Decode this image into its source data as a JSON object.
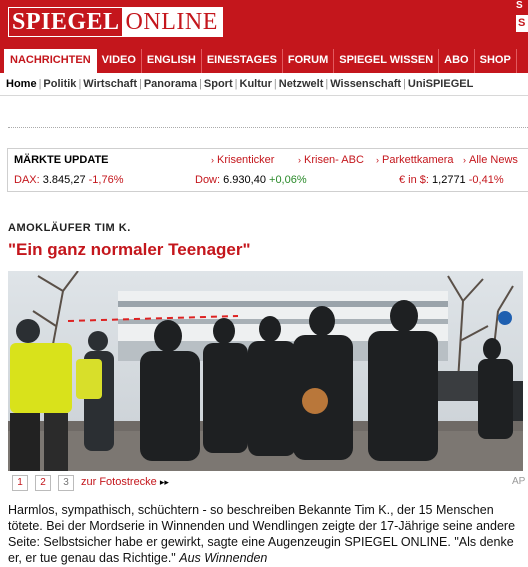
{
  "header": {
    "logo_left": "SPIEGEL",
    "logo_right": "ONLINE",
    "side_top": "S",
    "side_box": "S"
  },
  "nav": {
    "items": [
      "NACHRICHTEN",
      "VIDEO",
      "ENGLISH",
      "EINESTAGES",
      "FORUM",
      "SPIEGEL WISSEN",
      "ABO",
      "SHOP"
    ]
  },
  "subnav": {
    "items": [
      "Home",
      "Politik",
      "Wirtschaft",
      "Panorama",
      "Sport",
      "Kultur",
      "Netzwelt",
      "Wissenschaft",
      "UniSPIEGEL"
    ],
    "separator": "|"
  },
  "market": {
    "title": "MÄRKTE UPDATE",
    "links": [
      "Krisenticker",
      "Krisen- ABC",
      "Parkettkamera",
      "Alle News"
    ],
    "indices": [
      {
        "label": "DAX:",
        "value": "3.845,27",
        "change": "-1,76%",
        "direction": "neg"
      },
      {
        "label": "Dow:",
        "value": "6.930,40",
        "change": "+0,06%",
        "direction": "pos"
      },
      {
        "label": "€ in $:",
        "value": "1,2771",
        "change": "-0,41%",
        "direction": "neg"
      }
    ]
  },
  "article": {
    "kicker": "AMOKLÄUFER TIM K.",
    "headline": "\"Ein ganz normaler Teenager\"",
    "photo_credit": "AP",
    "teaser": "Harmlos, sympathisch, schüchtern - so beschreiben Bekannte Tim K., der 15 Menschen tötete. Bei der Mordserie in Winnenden und Wendlingen zeigte der 17-Jährige seine andere Seite: Selbstsicher habe er gewirkt, sagte eine Augenzeugin SPIEGEL ONLINE. \"Als denke er, er tue genau das Richtige.\"",
    "teaser_location": "Aus Winnenden"
  },
  "gallery": {
    "pages": [
      "1",
      "2",
      "3"
    ],
    "link_label": "zur Fotostrecke",
    "link_arrows": "▸▸"
  },
  "colors": {
    "brand_red": "#c4161c",
    "positive_green": "#2a8a2a"
  }
}
